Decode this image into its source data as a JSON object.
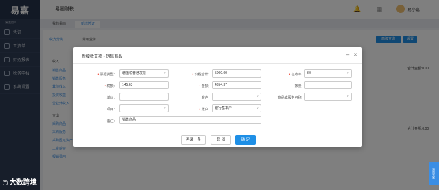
{
  "topbar": {
    "logo": "易嘉",
    "company": "易嘉财税",
    "username": "易小嘉"
  },
  "sidebar": {
    "user": "易嘉用户",
    "items": [
      {
        "label": "凭证"
      },
      {
        "label": "工资单"
      },
      {
        "label": "财务报表"
      },
      {
        "label": "税务申报"
      },
      {
        "label": "系统设置"
      }
    ]
  },
  "tabs": [
    {
      "label": "我的桌面"
    },
    {
      "label": "新增凭证"
    }
  ],
  "background": {
    "side_tabs": [
      "收支分类",
      "常用业务"
    ],
    "list": [
      "收入",
      "销售商品",
      "销售服务",
      "其他收入",
      "投资收益",
      "营业外收入",
      "支出",
      "采购商品",
      "采购服务",
      "采购固定资产",
      "工资薪金",
      "报销费用"
    ],
    "right_buttons": [
      "高级查询",
      "设置"
    ],
    "total_labels": [
      "合计金额:0.00",
      "合计金额:0.00"
    ]
  },
  "modal": {
    "title": "新增收支项 - 销售商品",
    "fields": {
      "invoice_type_label": "票据类型:",
      "invoice_type_value": "增值税普通发票",
      "price_total_label": "价税合计:",
      "price_total_value": "5000.00",
      "tax_rate_label": "征收率:",
      "tax_rate_value": "3%",
      "tax_label": "税额:",
      "tax_value": "145.63",
      "amount_label": "金额:",
      "amount_value": "4854.37",
      "qty_label": "数量:",
      "qty_value": "",
      "unit_price_label": "单价:",
      "unit_price_value": "",
      "customer_label": "客户:",
      "customer_value": "",
      "goods_name_label": "商品或服务名称:",
      "goods_name_value": "",
      "project_label": "项目:",
      "project_value": "",
      "account_label": "账户:",
      "account_value": "银行基本户",
      "remark_label": "备注:",
      "remark_value": "销售商品"
    },
    "buttons": {
      "save_another": "再录一条",
      "cancel": "取 消",
      "ok": "确 定"
    }
  },
  "watermark": "大数跨境",
  "help_tab": "咨询专家"
}
